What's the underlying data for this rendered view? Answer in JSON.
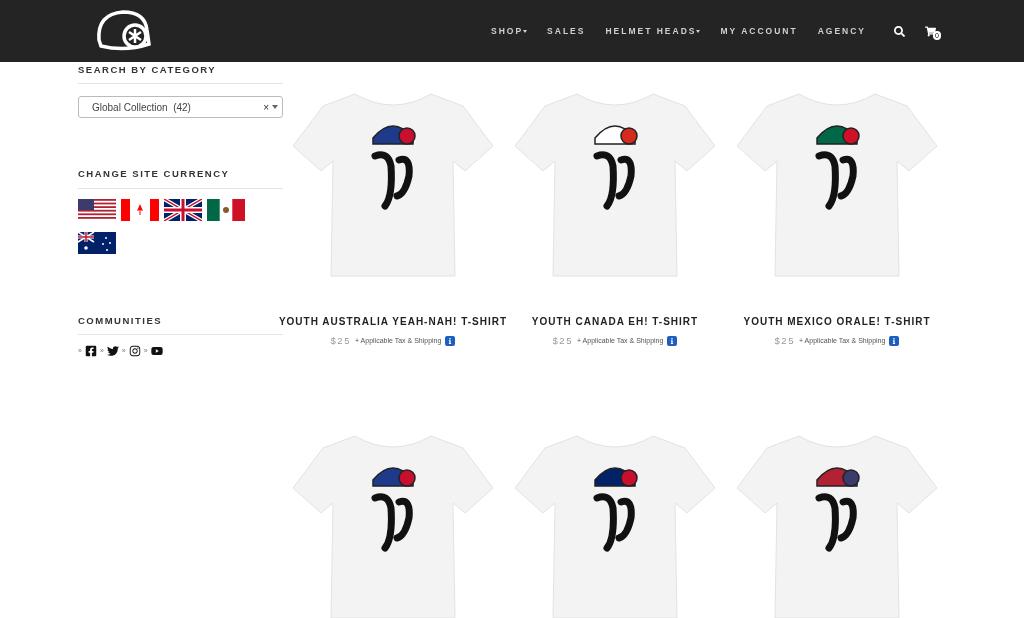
{
  "header": {
    "nav": [
      {
        "label": "SHOP",
        "dropdown": true
      },
      {
        "label": "SALES",
        "dropdown": false
      },
      {
        "label": "HELMET HEADS",
        "dropdown": true
      },
      {
        "label": "MY ACCOUNT",
        "dropdown": false
      },
      {
        "label": "AGENCY",
        "dropdown": false
      }
    ],
    "cart_count": "0"
  },
  "sidebar": {
    "category": {
      "heading": "SEARCH BY CATEGORY",
      "value": "Global Collection  (42)",
      "clear": "×"
    },
    "currency": {
      "heading": "CHANGE SITE CURRENCY",
      "flags": [
        {
          "kind": "usa"
        },
        {
          "kind": "canada"
        },
        {
          "kind": "uk"
        },
        {
          "kind": "mexico"
        },
        {
          "kind": "australia"
        }
      ]
    },
    "communities": {
      "heading": "COMMUNITIES",
      "links": [
        {
          "kind": "facebook"
        },
        {
          "kind": "twitter"
        },
        {
          "kind": "instagram"
        },
        {
          "kind": "youtube"
        }
      ],
      "separator": "»"
    }
  },
  "products": [
    {
      "kind": "australia",
      "title": "YOUTH AUSTRALIA YEAH-NAH! T-SHIRT",
      "price": "$25",
      "note": "+ Applicable Tax & Shipping"
    },
    {
      "kind": "canada",
      "title": "YOUTH CANADA EH! T-SHIRT",
      "price": "$25",
      "note": "+ Applicable Tax & Shipping"
    },
    {
      "kind": "mexico",
      "title": "YOUTH MEXICO ORALE! T-SHIRT",
      "price": "$25",
      "note": "+ Applicable Tax & Shipping"
    },
    {
      "kind": "australia"
    },
    {
      "kind": "uk"
    },
    {
      "kind": "usa"
    }
  ]
}
